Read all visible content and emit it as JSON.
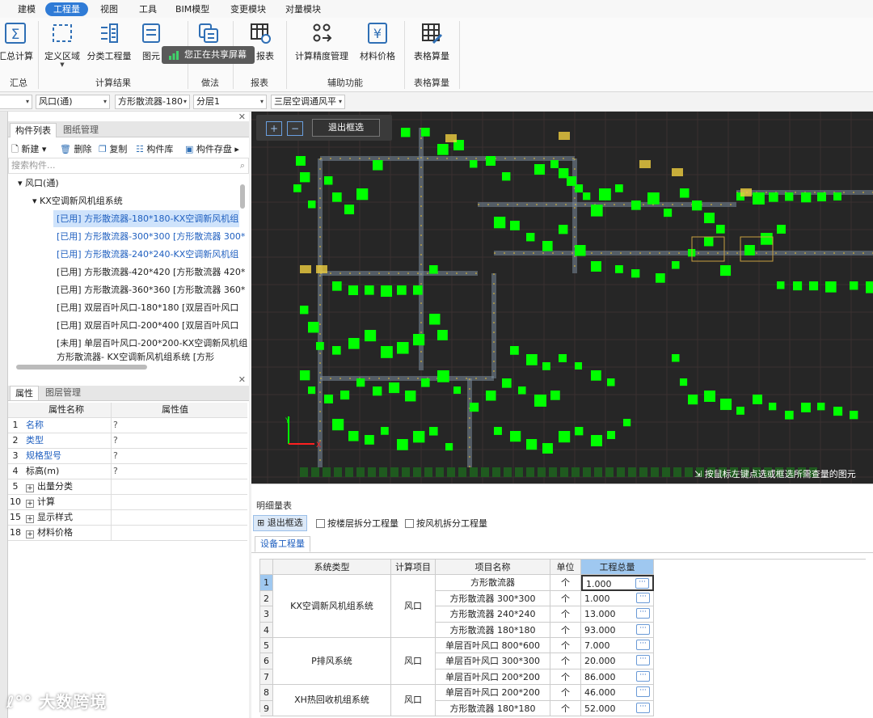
{
  "menu": {
    "items": [
      "建模",
      "工程量",
      "视图",
      "工具",
      "BIM模型",
      "变更模块",
      "对量模块"
    ],
    "active": "工程量"
  },
  "ribbon": {
    "buttons": {
      "summary_calc": "汇总计算",
      "define_region": "定义区域",
      "classified_qty": "分类工程量",
      "element_qty": "图元",
      "report": "报表",
      "calc_precision": "计算精度管理",
      "material_price": "材料价格",
      "table_calc": "表格算量"
    },
    "groups": {
      "summary": "汇总",
      "calc_result": "计算结果",
      "method": "做法",
      "report": "报表",
      "aux": "辅助功能",
      "table_calc": "表格算量"
    },
    "share_toast": "您正在共享屏幕"
  },
  "selectors": {
    "s1": "风口(通)",
    "s2": "方形散流器-180",
    "s3": "分层1",
    "s4": "三层空调通风平"
  },
  "left_panel": {
    "tabs": [
      "构件列表",
      "图纸管理"
    ],
    "toolbar": {
      "new": "新建",
      "delete": "删除",
      "copy": "复制",
      "library": "构件库",
      "save": "构件存盘"
    },
    "search_placeholder": "搜索构件...",
    "tree": {
      "root": "风口(通)",
      "system": "KX空调新风机组系统",
      "items": [
        "[已用] 方形散流器-180*180-KX空调新风机组",
        "[已用] 方形散流器-300*300 [方形散流器 300*",
        "[已用] 方形散流器-240*240-KX空调新风机组",
        "[已用] 方形散流器-420*420 [方形散流器 420*",
        "[已用] 方形散流器-360*360 [方形散流器 360*",
        "[已用] 双层百叶风口-180*180 [双层百叶风口",
        "[已用] 双层百叶风口-200*400 [双层百叶风口",
        "[未用] 单层百叶风口-200*200-KX空调新风机组",
        "方形散流器- KX空调新风机组系统 [方形"
      ]
    }
  },
  "props": {
    "tabs": [
      "属性",
      "图层管理"
    ],
    "headers": {
      "name": "属性名称",
      "value": "属性值"
    },
    "rows": [
      {
        "num": "1",
        "name": "名称",
        "value": "?",
        "link": true
      },
      {
        "num": "2",
        "name": "类型",
        "value": "?",
        "link": true
      },
      {
        "num": "3",
        "name": "规格型号",
        "value": "?",
        "link": true
      },
      {
        "num": "4",
        "name": "标高(m)",
        "value": "?",
        "link": false
      },
      {
        "num": "5",
        "name": "出量分类",
        "value": "",
        "group": true
      },
      {
        "num": "10",
        "name": "计算",
        "value": "",
        "group": true
      },
      {
        "num": "15",
        "name": "显示样式",
        "value": "",
        "group": true
      },
      {
        "num": "18",
        "name": "材料价格",
        "value": "",
        "group": true
      }
    ]
  },
  "canvas": {
    "exit_button": "退出框选",
    "hint": "按鼠标左键点选或框选所需查量的图元"
  },
  "detail": {
    "title": "明细量表",
    "exit_button": "退出框选",
    "check_floor": "按楼层拆分工程量",
    "check_fan": "按风机拆分工程量",
    "tab": "设备工程量",
    "columns": [
      "系统类型",
      "计算项目",
      "项目名称",
      "单位",
      "工程总量"
    ],
    "rows": [
      {
        "n": "1",
        "item": "方形散流器",
        "unit": "个",
        "total": "1.000"
      },
      {
        "n": "2",
        "item": "方形散流器 300*300",
        "unit": "个",
        "total": "1.000"
      },
      {
        "n": "3",
        "item": "方形散流器 240*240",
        "unit": "个",
        "total": "13.000"
      },
      {
        "n": "4",
        "item": "方形散流器 180*180",
        "unit": "个",
        "total": "93.000"
      },
      {
        "n": "5",
        "item": "单层百叶风口 800*600",
        "unit": "个",
        "total": "7.000"
      },
      {
        "n": "6",
        "item": "单层百叶风口 300*300",
        "unit": "个",
        "total": "20.000"
      },
      {
        "n": "7",
        "item": "单层百叶风口 200*200",
        "unit": "个",
        "total": "86.000"
      },
      {
        "n": "8",
        "item": "单层百叶风口 200*200",
        "unit": "个",
        "total": "46.000"
      },
      {
        "n": "9",
        "item": "方形散流器 180*180",
        "unit": "个",
        "total": "52.000"
      }
    ],
    "groups": [
      {
        "system": "KX空调新风机组系统",
        "calc": "风口"
      },
      {
        "system": "P排风系统",
        "calc": "风口"
      },
      {
        "system": "XH热回收机组系统",
        "calc": "风口"
      }
    ],
    "ellipsis": "···"
  },
  "watermark": "大数跨境",
  "colors": {
    "accent": "#2f7bd6",
    "selected_green": "#00ff00",
    "canvas_bg": "#262626"
  }
}
